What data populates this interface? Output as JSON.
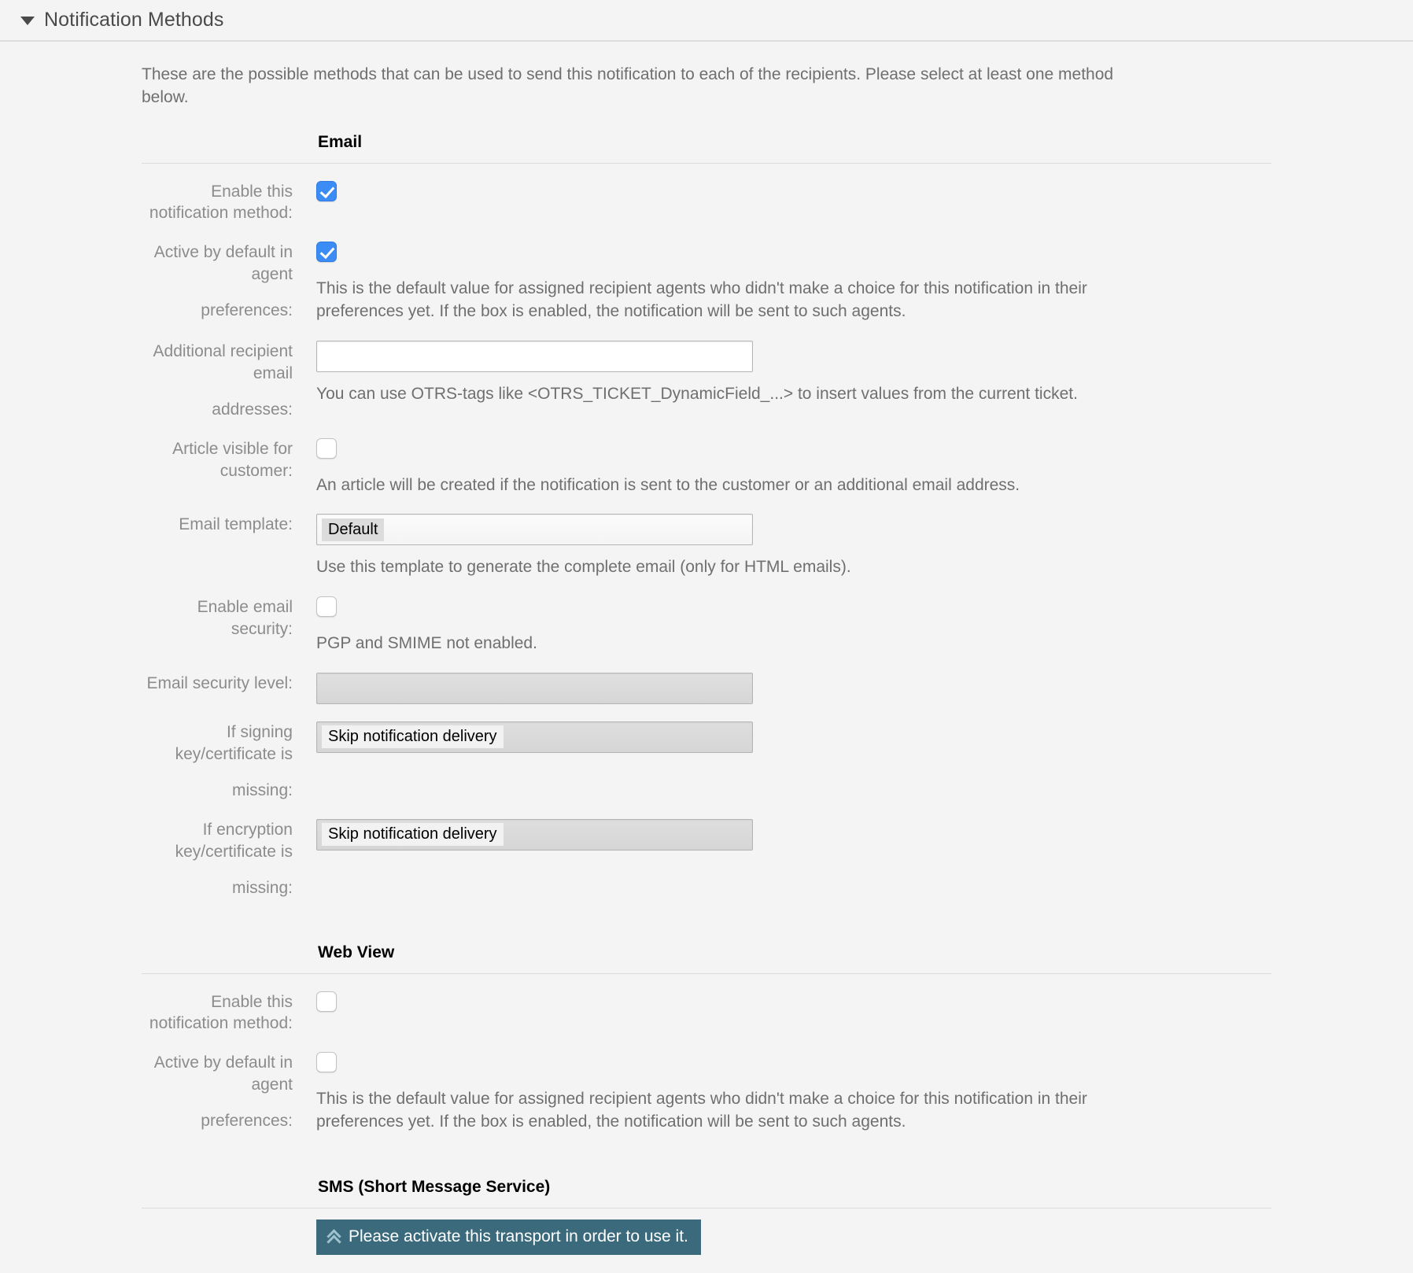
{
  "widget": {
    "title": "Notification Methods",
    "collapse_icon": "triangle-down-icon",
    "intro": "These are the possible methods that can be used to send this notification to each of the recipients. Please select at least one method below."
  },
  "colors": {
    "page_background": "#f4f4f4",
    "checkbox_checked": "#3c8cf5",
    "activate_button": "#3a6a7c",
    "activate_button_icon": "#9fc2cf",
    "label_text": "#8c8c8c",
    "help_text": "#6f6f6f",
    "heading_text": "#000000"
  },
  "sections": [
    {
      "heading": "Email",
      "fields": {
        "enable_method_label": "Enable this notification method:",
        "enable_method_checked": true,
        "active_default_label": "Active by default in agent preferences:",
        "active_default_label_line1": "Active by default in agent",
        "active_default_label_line2": "preferences:",
        "active_default_checked": true,
        "active_default_help": "This is the default value for assigned recipient agents who didn't make a choice for this notification in their preferences yet. If the box is enabled, the notification will be sent to such agents.",
        "recipient_label_line1": "Additional recipient email",
        "recipient_label_line2": "addresses:",
        "recipient_value": "",
        "recipient_placeholder": "",
        "recipient_help": "You can use OTRS-tags like <OTRS_TICKET_DynamicField_...> to insert values from the current ticket.",
        "article_visible_label": "Article visible for customer:",
        "article_visible_checked": false,
        "article_visible_help": "An article will be created if the notification is sent to the customer or an additional email address.",
        "email_template_label": "Email template:",
        "email_template_value": "Default",
        "email_template_help": "Use this template to generate the complete email (only for HTML emails).",
        "email_security_label": "Enable email security:",
        "email_security_checked": false,
        "email_security_help": "PGP and SMIME not enabled.",
        "security_level_label": "Email security level:",
        "security_level_value": "",
        "signing_label_line1": "If signing key/certificate is",
        "signing_label_line2": "missing:",
        "signing_value": "Skip notification delivery",
        "encryption_label_line1": "If encryption key/certificate is",
        "encryption_label_line2": "missing:",
        "encryption_value": "Skip notification delivery"
      }
    },
    {
      "heading": "Web View",
      "fields": {
        "enable_method_label": "Enable this notification method:",
        "enable_method_checked": false,
        "active_default_label_line1": "Active by default in agent",
        "active_default_label_line2": "preferences:",
        "active_default_checked": false,
        "active_default_help": "This is the default value for assigned recipient agents who didn't make a choice for this notification in their preferences yet. If the box is enabled, the notification will be sent to such agents."
      }
    },
    {
      "heading": "SMS (Short Message Service)",
      "fields": {
        "activate_button_label": "Please activate this transport in order to use it.",
        "activate_button_icon": "chevron-double-up-icon"
      }
    }
  ]
}
